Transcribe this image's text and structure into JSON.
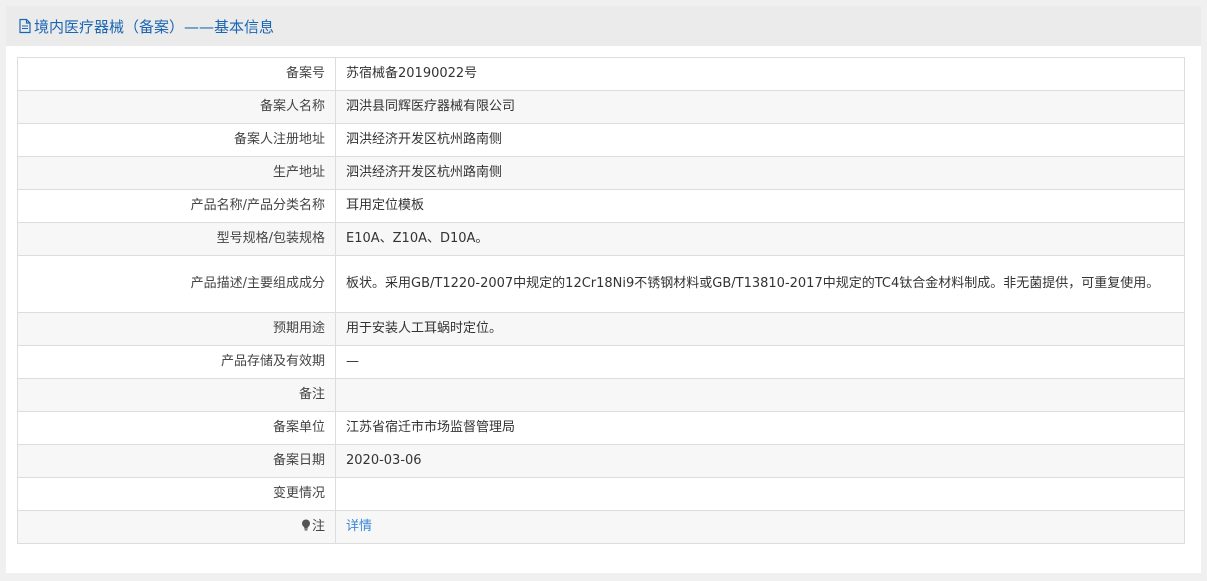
{
  "header": {
    "title": "境内医疗器械（备案）——基本信息",
    "icon": "document-icon"
  },
  "rows": [
    {
      "label": "备案号",
      "value": "苏宿械备20190022号"
    },
    {
      "label": "备案人名称",
      "value": "泗洪县同辉医疗器械有限公司"
    },
    {
      "label": "备案人注册地址",
      "value": "泗洪经济开发区杭州路南侧"
    },
    {
      "label": "生产地址",
      "value": "泗洪经济开发区杭州路南侧"
    },
    {
      "label": "产品名称/产品分类名称",
      "value": "耳用定位模板"
    },
    {
      "label": "型号规格/包装规格",
      "value": "E10A、Z10A、D10A。"
    },
    {
      "label": "产品描述/主要组成成分",
      "value": "板状。采用GB/T1220-2007中规定的12Cr18Ni9不锈钢材料或GB/T13810-2017中规定的TC4钛合金材料制成。非无菌提供，可重复使用。"
    },
    {
      "label": "预期用途",
      "value": "用于安装人工耳蜗时定位。"
    },
    {
      "label": "产品存储及有效期",
      "value": "—"
    },
    {
      "label": "备注",
      "value": ""
    },
    {
      "label": "备案单位",
      "value": "江苏省宿迁市市场监督管理局"
    },
    {
      "label": "备案日期",
      "value": "2020-03-06"
    },
    {
      "label": "变更情况",
      "value": ""
    },
    {
      "label": "注",
      "value": "详情",
      "icon": "lightbulb-icon"
    }
  ],
  "colors": {
    "title": "#1a66b3",
    "link": "#3a87d6",
    "header_bg": "#ebebeb",
    "alt_row_bg": "#f7f7f7",
    "border": "#dddddd"
  }
}
